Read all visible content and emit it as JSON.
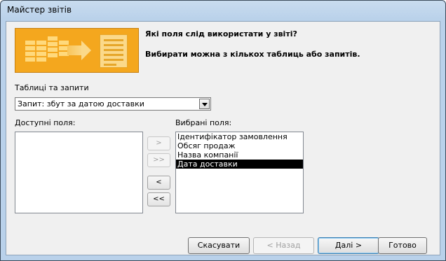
{
  "window": {
    "title": "Майстер звітів"
  },
  "header": {
    "question": "Які поля слід використати у звіті?",
    "hint": "Вибирати можна з кількох таблиць або запитів."
  },
  "tables": {
    "label": "Таблиці та запити",
    "selected": "Запит: збут за датою доставки"
  },
  "available": {
    "label": "Доступні поля:",
    "items": []
  },
  "selected_fields": {
    "label": "Вибрані поля:",
    "items": [
      "Ідентифікатор замовлення",
      "Обсяг продаж",
      "Назва компанії",
      "Дата доставки"
    ],
    "selected_index": 3
  },
  "move_buttons": {
    "add_one": ">",
    "add_all": ">>",
    "remove_one": "<",
    "remove_all": "<<"
  },
  "footer": {
    "cancel": "Скасувати",
    "back": "< Назад",
    "next": "Далі >",
    "finish": "Готово"
  }
}
